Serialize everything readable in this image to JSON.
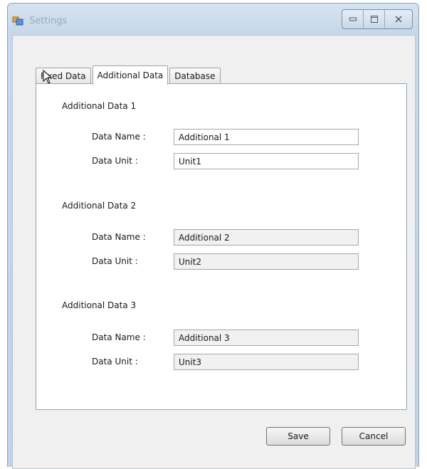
{
  "window": {
    "title": "Settings"
  },
  "tabs": [
    {
      "label": "Fixed Data",
      "active": false
    },
    {
      "label": "Additional Data",
      "active": true
    },
    {
      "label": "Database",
      "active": false
    }
  ],
  "groups": [
    {
      "title": "Additional Data 1",
      "name_label": "Data Name :",
      "name_value": "Additional 1",
      "unit_label": "Data Unit :",
      "unit_value": "Unit1"
    },
    {
      "title": "Additional Data 2",
      "name_label": "Data Name :",
      "name_value": "Additional 2",
      "unit_label": "Data Unit :",
      "unit_value": "Unit2"
    },
    {
      "title": "Additional Data 3",
      "name_label": "Data Name :",
      "name_value": "Additional 3",
      "unit_label": "Data Unit :",
      "unit_value": "Unit3"
    }
  ],
  "buttons": {
    "save": "Save",
    "cancel": "Cancel"
  },
  "icons": {
    "app": "settings-app-icon",
    "minimize": "minimize-icon",
    "maximize": "maximize-icon",
    "close": "close-icon",
    "cursor": "mouse-pointer-icon"
  }
}
